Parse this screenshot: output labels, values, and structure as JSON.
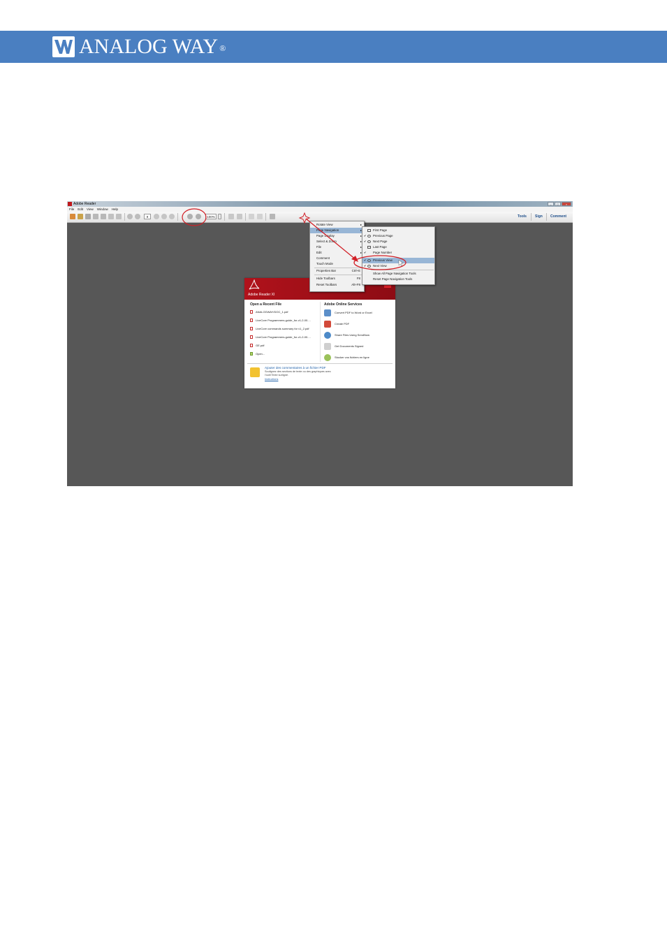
{
  "header": {
    "brand_name": "ANALOG WAY",
    "registered_mark": "®"
  },
  "app_window": {
    "title": "Adobe Reader",
    "menus": [
      "File",
      "Edit",
      "View",
      "Window",
      "Help"
    ],
    "page_number": "9",
    "zoom": "100%",
    "right_tools": [
      "Tools",
      "Sign",
      "Comment"
    ]
  },
  "context_menu": {
    "items": [
      {
        "label": "Rotate View",
        "submenu": true
      },
      {
        "label": "Page Navigation",
        "submenu": true,
        "highlighted": true
      },
      {
        "label": "Page Display",
        "submenu": true
      },
      {
        "label": "Select & Zoom",
        "submenu": true
      },
      {
        "label": "File",
        "submenu": true
      },
      {
        "label": "Edit",
        "submenu": true
      },
      {
        "label": "Comment",
        "submenu": false
      },
      {
        "label": "Touch Mode",
        "submenu": false
      },
      {
        "label": "Properties Bar",
        "shortcut": "Ctrl+E"
      },
      {
        "label": "Hide Toolbars",
        "shortcut": "F8"
      },
      {
        "label": "Reset Toolbars",
        "shortcut": "Alt+F8"
      }
    ]
  },
  "submenu": {
    "items": [
      {
        "label": "First Page",
        "checked": false
      },
      {
        "label": "Previous Page",
        "checked": true
      },
      {
        "label": "Next Page",
        "checked": true
      },
      {
        "label": "Last Page",
        "checked": false
      },
      {
        "label": "Page Number",
        "checked": true
      },
      {
        "label": "Previous View",
        "checked": true,
        "highlighted": true
      },
      {
        "label": "Next View",
        "checked": true
      },
      {
        "label": "Show All Page Navigation Tools",
        "checked": false
      },
      {
        "label": "Reset Page Navigation Tools",
        "checked": false
      }
    ]
  },
  "welcome": {
    "product": "Adobe Reader XI",
    "recent_title": "Open a Recent File",
    "recent_files": [
      "ANALOGWAY/DOC_1.pdf",
      "LiveCore Programmers-guide_for-v1-2-00....",
      "LiveCore commands summary for v1_2.pdf",
      "LiveCore Programmers-guide_for-v1-2-00....",
      "GE.pdf",
      "Open..."
    ],
    "services_title": "Adobe Online Services",
    "services": [
      "Convert PDF to Word or Excel",
      "Create PDF",
      "Share Files Using SendNow",
      "Get Documents Signed",
      "Stocker vos fichiers en ligne"
    ],
    "tip_title": "Ajouter des commentaires à un fichier PDF",
    "tip_body": "Soulignez des sections de texte ou des graphiques avec l'outil Texte surligné.",
    "tip_link": "Instructions"
  },
  "colors": {
    "banner": "#4a7fc1",
    "workspace": "#575757",
    "annotation": "#d11f26",
    "adobe_red": "#b0121b"
  }
}
